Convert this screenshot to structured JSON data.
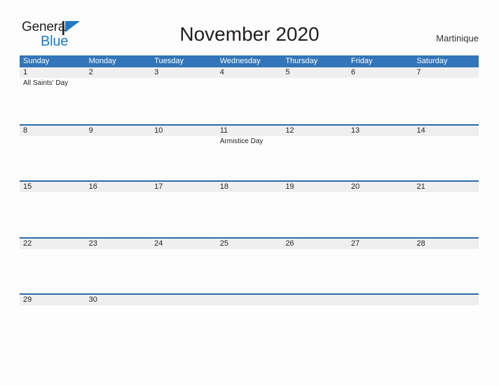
{
  "brand": {
    "word_one": "General",
    "word_two": "Blue",
    "flag_icon": "flag-icon",
    "accent_color": "#1f7ac4"
  },
  "header": {
    "title": "November 2020",
    "region": "Martinique"
  },
  "theme": {
    "header_blue": "#3275b8",
    "rule_blue": "#2b6ca8",
    "band_gray": "#efefef",
    "page_background": "#fdfdfd",
    "text_color": "#231f20"
  },
  "calendar": {
    "month": "November",
    "year": "2020",
    "day_names": [
      "Sunday",
      "Monday",
      "Tuesday",
      "Wednesday",
      "Thursday",
      "Friday",
      "Saturday"
    ],
    "weeks": [
      [
        {
          "day": "1",
          "events": [
            "All Saints' Day"
          ]
        },
        {
          "day": "2",
          "events": []
        },
        {
          "day": "3",
          "events": []
        },
        {
          "day": "4",
          "events": []
        },
        {
          "day": "5",
          "events": []
        },
        {
          "day": "6",
          "events": []
        },
        {
          "day": "7",
          "events": []
        }
      ],
      [
        {
          "day": "8",
          "events": []
        },
        {
          "day": "9",
          "events": []
        },
        {
          "day": "10",
          "events": []
        },
        {
          "day": "11",
          "events": [
            "Armistice Day"
          ]
        },
        {
          "day": "12",
          "events": []
        },
        {
          "day": "13",
          "events": []
        },
        {
          "day": "14",
          "events": []
        }
      ],
      [
        {
          "day": "15",
          "events": []
        },
        {
          "day": "16",
          "events": []
        },
        {
          "day": "17",
          "events": []
        },
        {
          "day": "18",
          "events": []
        },
        {
          "day": "19",
          "events": []
        },
        {
          "day": "20",
          "events": []
        },
        {
          "day": "21",
          "events": []
        }
      ],
      [
        {
          "day": "22",
          "events": []
        },
        {
          "day": "23",
          "events": []
        },
        {
          "day": "24",
          "events": []
        },
        {
          "day": "25",
          "events": []
        },
        {
          "day": "26",
          "events": []
        },
        {
          "day": "27",
          "events": []
        },
        {
          "day": "28",
          "events": []
        }
      ],
      [
        {
          "day": "29",
          "events": []
        },
        {
          "day": "30",
          "events": []
        },
        {
          "day": "",
          "events": []
        },
        {
          "day": "",
          "events": []
        },
        {
          "day": "",
          "events": []
        },
        {
          "day": "",
          "events": []
        },
        {
          "day": "",
          "events": []
        }
      ]
    ]
  }
}
